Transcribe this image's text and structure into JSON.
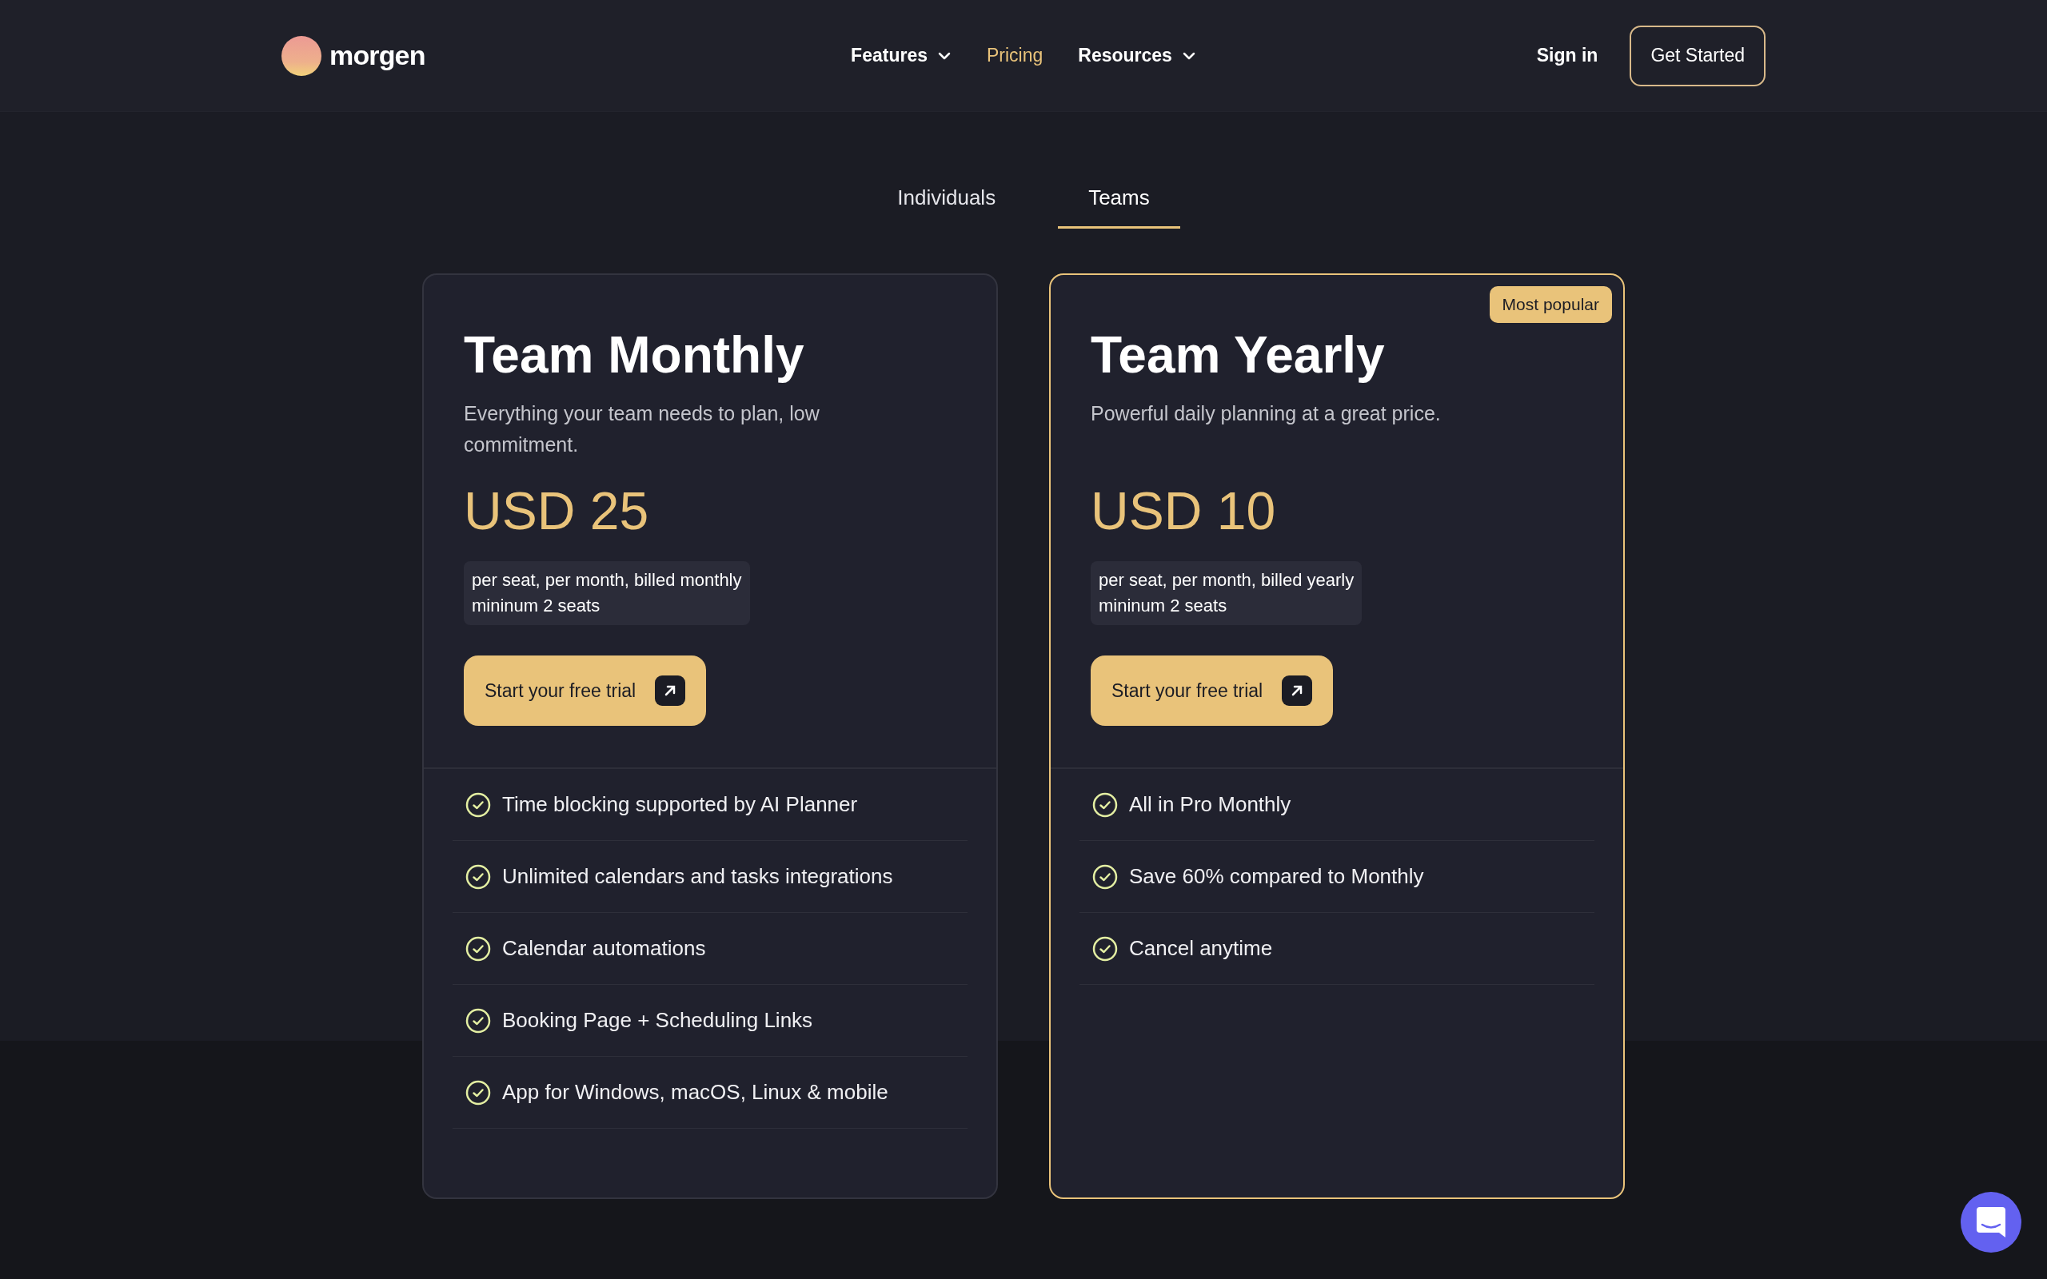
{
  "header": {
    "logo_text": "morgen",
    "nav": [
      {
        "label": "Features",
        "selected": false,
        "dropdown": true
      },
      {
        "label": "Pricing",
        "selected": true,
        "dropdown": false
      },
      {
        "label": "Resources",
        "selected": false,
        "dropdown": true
      }
    ],
    "sign_in": "Sign in",
    "cta": "Get Started"
  },
  "tabs": [
    {
      "label": "Individuals",
      "selected": false
    },
    {
      "label": "Teams",
      "selected": true
    }
  ],
  "plans": [
    {
      "title": "Team Monthly",
      "description": "Everything your team needs to plan, low commitment.",
      "highlighted": false,
      "price": "USD 25",
      "billing": [
        "per seat, per month, billed monthly",
        "mininum 2 seats"
      ],
      "button": "Start your free trial",
      "features": [
        "Time blocking supported by AI Planner",
        "Unlimited calendars and tasks integrations",
        "Calendar automations",
        "Booking Page + Scheduling Links",
        "App for Windows, macOS, Linux & mobile"
      ]
    },
    {
      "title": "Team Yearly",
      "description": "Powerful daily planning at a great price.",
      "highlighted": true,
      "badge": "Most popular",
      "price": "USD 10",
      "billing": [
        "per seat, per month, billed yearly",
        "mininum 2 seats"
      ],
      "button": "Start your free trial",
      "features": [
        "All in Pro Monthly",
        "Save 60% compared to Monthly",
        "Cancel anytime"
      ]
    }
  ]
}
